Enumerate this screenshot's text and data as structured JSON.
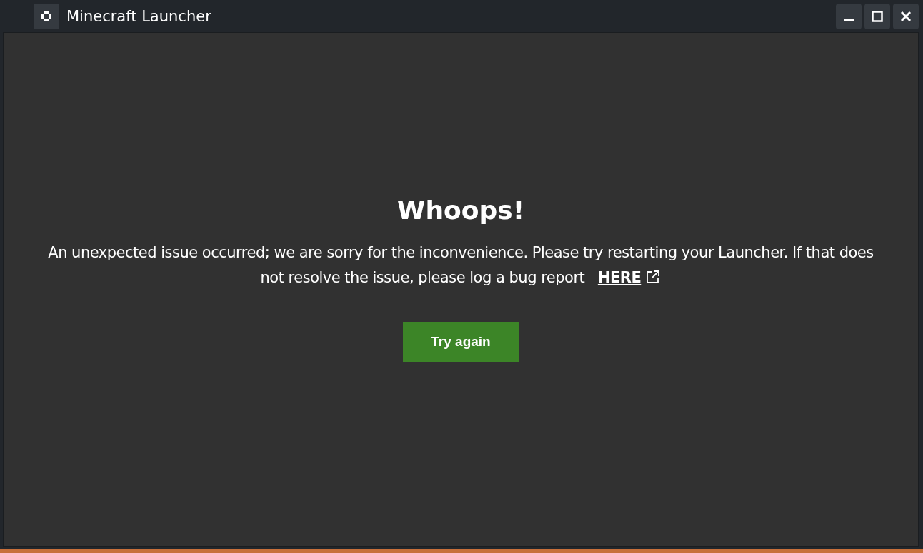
{
  "window": {
    "title": "Minecraft Launcher"
  },
  "error": {
    "heading": "Whoops!",
    "message": "An unexpected issue occurred; we are sorry for the inconvenience. Please try restarting your Launcher. If that does not resolve the issue, please log a bug report",
    "link": "HERE",
    "button": "Try again"
  }
}
